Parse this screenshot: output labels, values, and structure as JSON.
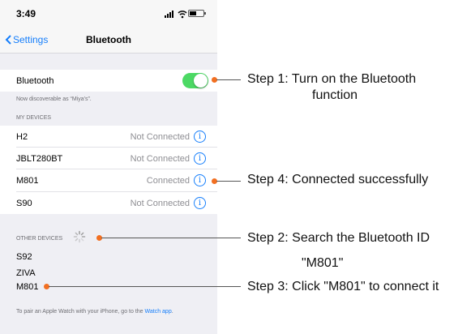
{
  "status_bar": {
    "time": "3:49"
  },
  "nav": {
    "back_label": "Settings",
    "title": "Bluetooth"
  },
  "bluetooth": {
    "label": "Bluetooth",
    "enabled": true,
    "discoverable_text": "Now discoverable as “Miya's”."
  },
  "my_devices": {
    "header": "MY DEVICES",
    "items": [
      {
        "name": "H2",
        "status": "Not Connected"
      },
      {
        "name": "JBLT280BT",
        "status": "Not Connected"
      },
      {
        "name": "M801",
        "status": "Connected"
      },
      {
        "name": "S90",
        "status": "Not Connected"
      }
    ]
  },
  "other_devices": {
    "header": "OTHER DEVICES",
    "items": [
      "S92",
      "ZIVA",
      "M801"
    ]
  },
  "footer": {
    "text": "To pair an Apple Watch with your iPhone, go to the ",
    "link": "Watch app",
    "end": "."
  },
  "annotations": {
    "step1_line1": "Step 1: Turn on the Bluetooth",
    "step1_line2": "function",
    "step4": "Step 4: Connected successfully",
    "step2_line1": "Step 2: Search the Bluetooth ID",
    "step2_line2": "\"M801\"",
    "step3": "Step 3: Click \"M801\" to connect it"
  },
  "colors": {
    "accent": "#157efb",
    "toggle_on": "#4cd964",
    "marker": "#f26f21",
    "background": "#efeff4"
  }
}
